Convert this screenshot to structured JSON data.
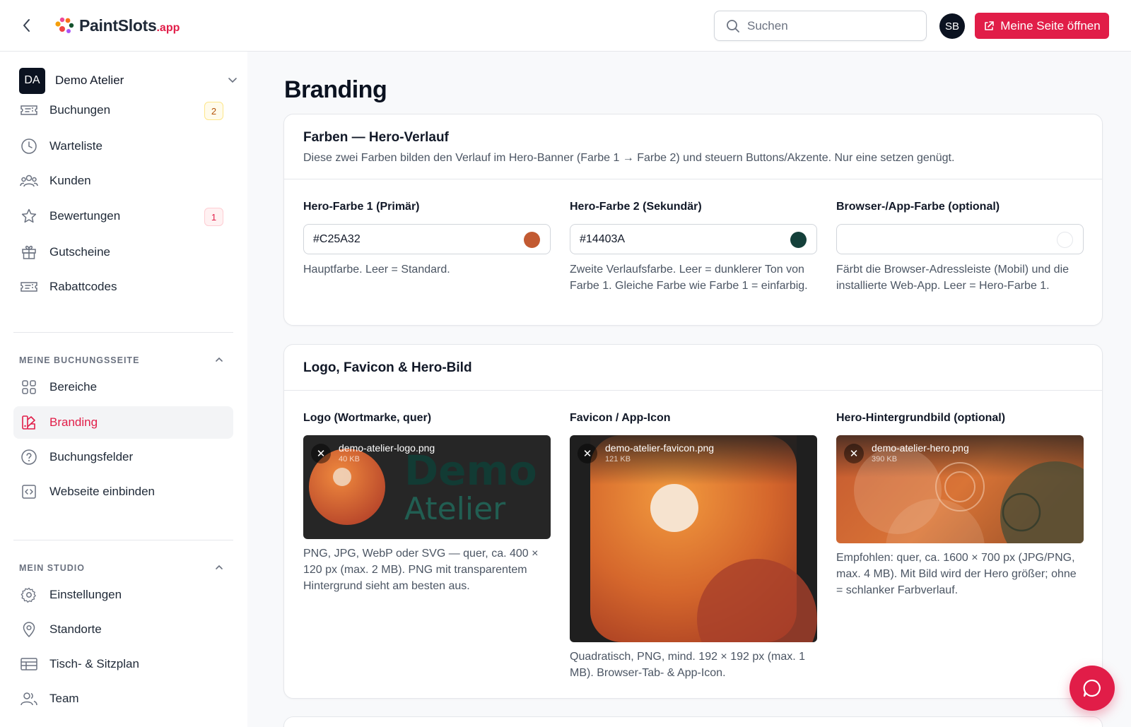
{
  "header": {
    "logo_main": "PaintSlots",
    "logo_tld": ".app",
    "search_placeholder": "Suchen",
    "avatar_initials": "SB",
    "open_button_label": "Meine Seite öffnen",
    "accent_color": "#e11d48"
  },
  "sidebar": {
    "workspace": {
      "initials": "DA",
      "name": "Demo Atelier"
    },
    "items": [
      {
        "label": "Buchungen",
        "icon": "ticket-icon",
        "badge": "2"
      },
      {
        "label": "Warteliste",
        "icon": "clock-icon"
      },
      {
        "label": "Kunden",
        "icon": "users-icon"
      },
      {
        "label": "Bewertungen",
        "icon": "star-icon",
        "badge": "1"
      },
      {
        "label": "Gutscheine",
        "icon": "gift-icon"
      },
      {
        "label": "Rabattcodes",
        "icon": "ticket-icon"
      }
    ],
    "section_booking": {
      "title": "MEINE BUCHUNGSSEITE",
      "items": [
        {
          "label": "Bereiche",
          "icon": "grid-icon"
        },
        {
          "label": "Branding",
          "icon": "palette-icon",
          "active": true
        },
        {
          "label": "Buchungsfelder",
          "icon": "help-circle-icon"
        },
        {
          "label": "Webseite einbinden",
          "icon": "code-icon"
        }
      ]
    },
    "section_studio": {
      "title": "MEIN STUDIO",
      "items": [
        {
          "label": "Einstellungen",
          "icon": "gear-icon"
        },
        {
          "label": "Standorte",
          "icon": "map-pin-icon"
        },
        {
          "label": "Tisch- & Sitzplan",
          "icon": "table-icon"
        },
        {
          "label": "Team",
          "icon": "team-icon"
        }
      ]
    }
  },
  "main": {
    "page_title": "Branding",
    "colors_card": {
      "title": "Farben — Hero-Verlauf",
      "description": "Diese zwei Farben bilden den Verlauf im Hero-Banner (Farbe 1 → Farbe 2) und steuern Buttons/Akzente. Nur eine setzen genügt.",
      "fields": [
        {
          "label": "Hero-Farbe 1 (Primär)",
          "value": "#C25A32",
          "swatch": "#C25A32",
          "help": "Hauptfarbe. Leer = Standard."
        },
        {
          "label": "Hero-Farbe 2 (Sekundär)",
          "value": "#14403A",
          "swatch": "#14403A",
          "help": "Zweite Verlaufsfarbe. Leer = dunklerer Ton von Farbe 1. Gleiche Farbe wie Farbe 1 = einfarbig."
        },
        {
          "label": "Browser-/App-Farbe (optional)",
          "value": "",
          "swatch": "",
          "help": "Färbt die Browser-Adressleiste (Mobil) und die installierte Web-App. Leer = Hero-Farbe 1."
        }
      ]
    },
    "media_card": {
      "title": "Logo, Favicon & Hero-Bild",
      "uploads": [
        {
          "label": "Logo (Wortmarke, quer)",
          "file_name": "demo-atelier-logo.png",
          "file_size": "40 KB",
          "logo_text_1": "Demo",
          "logo_text_2": "Atelier",
          "help": "PNG, JPG, WebP oder SVG — quer, ca. 400 × 120 px (max. 2 MB). PNG mit transparentem Hintergrund sieht am besten aus."
        },
        {
          "label": "Favicon / App-Icon",
          "file_name": "demo-atelier-favicon.png",
          "file_size": "121 KB",
          "help": "Quadratisch, PNG, mind. 192 × 192 px (max. 1 MB). Browser-Tab- & App-Icon."
        },
        {
          "label": "Hero-Hintergrundbild (optional)",
          "file_name": "demo-atelier-hero.png",
          "file_size": "390 KB",
          "help": "Empfohlen: quer, ca. 1600 × 700 px (JPG/PNG, max. 4 MB). Mit Bild wird der Hero größer; ohne = schlanker Farbverlauf."
        }
      ]
    }
  },
  "chat_button_icon": "chat-icon"
}
